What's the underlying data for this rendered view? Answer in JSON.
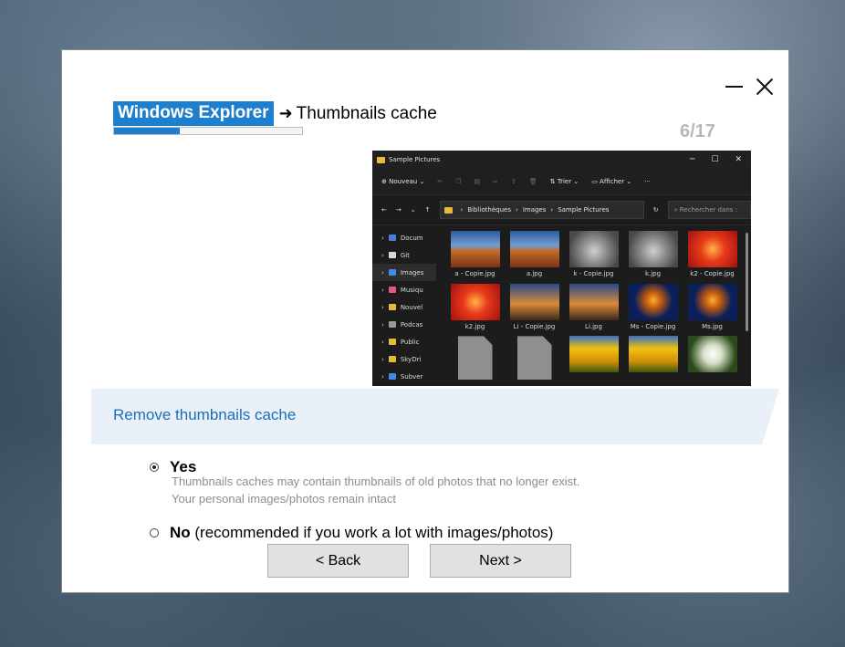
{
  "header": {
    "badge": "Windows Explorer",
    "arrow": "➜",
    "title": "Thumbnails cache",
    "step": "6/17",
    "progress_fraction": 0.35
  },
  "explorer": {
    "window_title": "Sample Pictures",
    "toolbar": {
      "new": "Nouveau",
      "sort": "Trier",
      "view": "Afficher",
      "more": "···"
    },
    "breadcrumb": [
      "Bibliothèques",
      "Images",
      "Sample Pictures"
    ],
    "search_placeholder": "Rechercher dans :",
    "nav": [
      "Docum",
      "Git",
      "Images",
      "Musiqu",
      "Nouvel",
      "Podcas",
      "Public",
      "SkyDri",
      "Subver"
    ],
    "files": [
      "a - Copie.jpg",
      "a.jpg",
      "k - Copie.jpg",
      "k.jpg",
      "k2 - Copie.jpg",
      "k2.jpg",
      "Li - Copie.jpg",
      "Li.jpg",
      "Ms - Copie.jpg",
      "Ms.jpg",
      "",
      "",
      "",
      "",
      ""
    ]
  },
  "section": {
    "title": "Remove thumbnails cache"
  },
  "options": {
    "yes": {
      "label": "Yes",
      "desc1": "Thumbnails caches may contain thumbnails of old photos that no longer exist.",
      "desc2": "Your personal images/photos remain intact",
      "selected": true
    },
    "no": {
      "label": "No",
      "note": " (recommended if you work a lot with images/photos)",
      "selected": false
    }
  },
  "buttons": {
    "back": "< Back",
    "next": "Next >"
  },
  "colors": {
    "accent": "#1f7fcf",
    "banner_bg": "#eaf0f8",
    "banner_text": "#1a6fb8"
  }
}
